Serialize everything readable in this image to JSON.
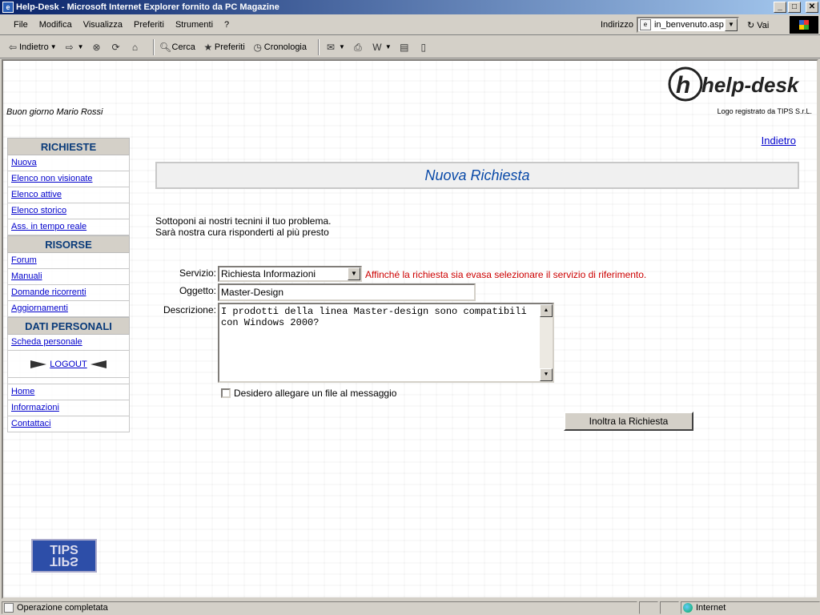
{
  "window": {
    "title": "Help-Desk - Microsoft Internet Explorer fornito da PC Magazine",
    "buttons": {
      "minimize": "_",
      "maximize": "□",
      "close": "✕"
    }
  },
  "menubar": {
    "items": [
      "File",
      "Modifica",
      "Visualizza",
      "Preferiti",
      "Strumenti",
      "?"
    ],
    "address_label": "Indirizzo",
    "address_value": "in_benvenuto.asp",
    "go_label": "Vai"
  },
  "toolbar": {
    "back": "Indietro",
    "search": "Cerca",
    "favorites": "Preferiti",
    "history": "Cronologia"
  },
  "page": {
    "greeting": "Buon giorno Mario Rossi",
    "logo_text": "help-desk",
    "logo_note": "Logo registrato da TIPS S.r.L.",
    "back_link": "Indietro",
    "title": "Nuova Richiesta",
    "intro_line1": "Sottoponi ai nostri tecnini il tuo problema.",
    "intro_line2": "Sarà nostra cura risponderti al più presto",
    "tips_logo": "TIPS"
  },
  "sidebar": {
    "richieste_header": "RICHIESTE",
    "richieste": [
      "Nuova",
      "Elenco non visionate",
      "Elenco attive",
      "Elenco storico",
      "Ass. in tempo reale"
    ],
    "risorse_header": "RISORSE",
    "risorse": [
      "Forum",
      "Manuali",
      "Domande ricorrenti",
      "Aggiornamenti"
    ],
    "dati_header": "DATI PERSONALI",
    "dati": [
      "Scheda personale"
    ],
    "logout": "LOGOUT",
    "footer": [
      "Home",
      "Informazioni",
      "Contattaci"
    ]
  },
  "form": {
    "servizio_label": "Servizio:",
    "servizio_value": "Richiesta Informazioni",
    "servizio_hint": "Affinché la richiesta sia evasa selezionare il servizio di riferimento.",
    "oggetto_label": "Oggetto:",
    "oggetto_value": "Master-Design",
    "descrizione_label": "Descrizione:",
    "descrizione_value": "I prodotti della linea Master-design sono compatibili con Windows 2000?",
    "attach_label": "Desidero allegare un file al messaggio",
    "submit_label": "Inoltra la Richiesta"
  },
  "statusbar": {
    "status": "Operazione completata",
    "zone": "Internet"
  }
}
